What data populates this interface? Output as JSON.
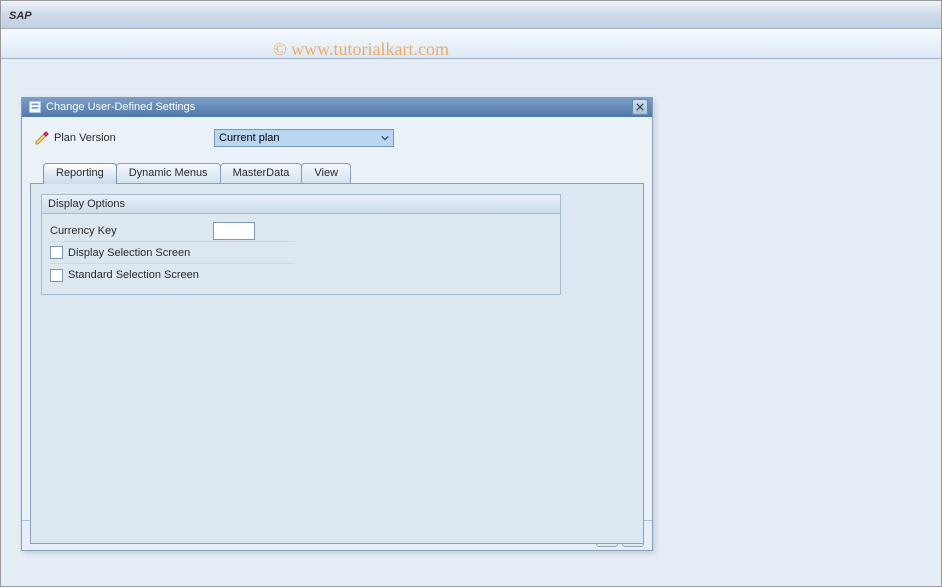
{
  "app": {
    "title": "SAP"
  },
  "watermark": "© www.tutorialkart.com",
  "dialog": {
    "title": "Change User-Defined Settings",
    "plan_version_label": "Plan Version",
    "plan_version_value": "Current plan",
    "tabs": [
      {
        "label": "Reporting"
      },
      {
        "label": "Dynamic Menus"
      },
      {
        "label": "MasterData"
      },
      {
        "label": "View"
      }
    ],
    "groupbox": {
      "title": "Display Options",
      "currency_key_label": "Currency Key",
      "currency_key_value": "",
      "check1_label": "Display Selection Screen",
      "check2_label": "Standard Selection Screen"
    }
  }
}
